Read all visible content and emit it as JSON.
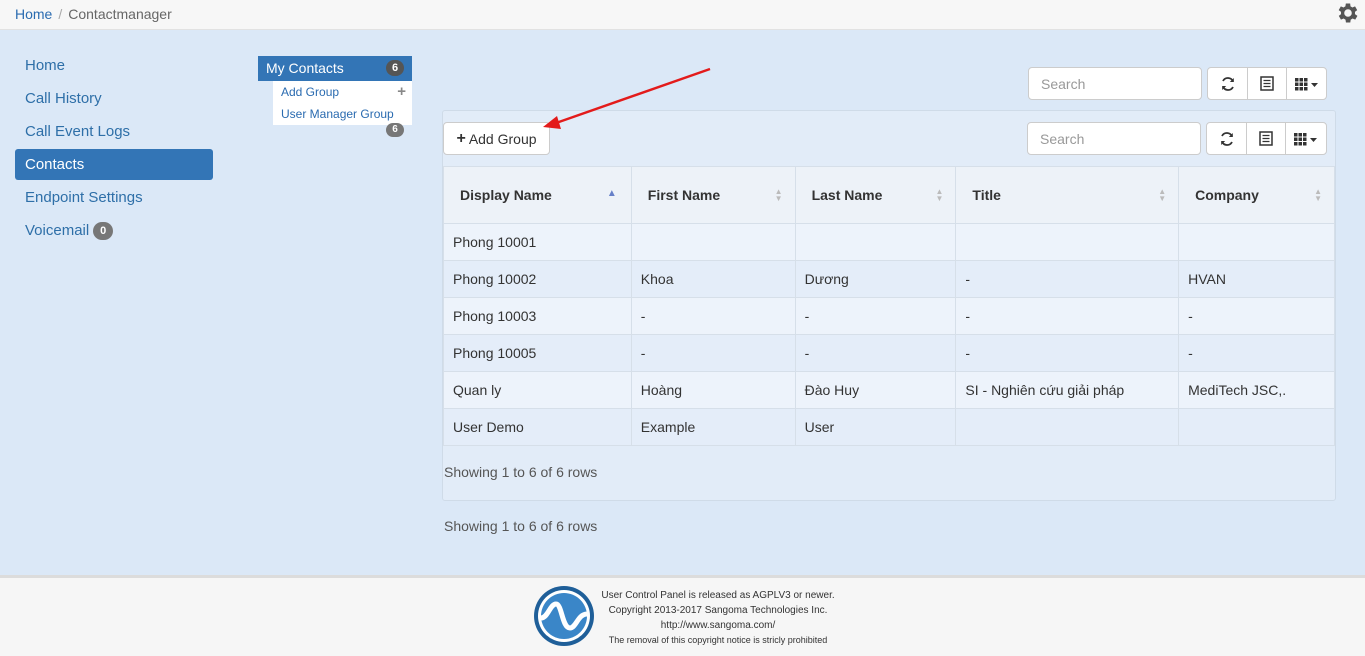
{
  "breadcrumb": {
    "home": "Home",
    "current": "Contactmanager"
  },
  "icons": {
    "settings": "gear-icon",
    "refresh": "refresh-icon",
    "toggle": "list-view-icon",
    "columns": "columns-grid-icon",
    "add": "plus-icon"
  },
  "nav": {
    "items": [
      {
        "label": "Home"
      },
      {
        "label": "Call History"
      },
      {
        "label": "Call Event Logs"
      },
      {
        "label": "Contacts"
      },
      {
        "label": "Endpoint Settings"
      },
      {
        "label": "Voicemail",
        "badge": "0"
      }
    ]
  },
  "groups": {
    "title": "My Contacts",
    "count": "6",
    "add_label": "Add Group",
    "user_manager_label": "User Manager Group",
    "user_manager_count": "6"
  },
  "toolbar": {
    "search_placeholder": "Search",
    "add_group_label": "Add Group"
  },
  "table": {
    "headers": [
      "Display Name",
      "First Name",
      "Last Name",
      "Title",
      "Company"
    ],
    "rows": [
      [
        "Phong 10001",
        "",
        "",
        "",
        ""
      ],
      [
        "Phong 10002",
        "Khoa",
        "Dương",
        "-",
        "HVAN"
      ],
      [
        "Phong 10003",
        "-",
        "-",
        "-",
        "-"
      ],
      [
        "Phong 10005",
        "-",
        "-",
        "-",
        "-"
      ],
      [
        "Quan ly",
        "Hoàng",
        "Đào Huy",
        "SI - Nghiên cứu giải pháp",
        "MediTech JSC,."
      ],
      [
        "User Demo",
        "Example",
        "User",
        "",
        ""
      ]
    ],
    "info": "Showing 1 to 6 of 6 rows"
  },
  "footer": {
    "line1": "User Control Panel is released as AGPLV3 or newer.",
    "line2": "Copyright 2013-2017 Sangoma Technologies Inc.",
    "line3": "http://www.sangoma.com/",
    "line4": "The removal of this copyright notice is stricly prohibited"
  },
  "colors": {
    "accent": "#3375b6",
    "annotation_arrow": "#e31b1b"
  }
}
